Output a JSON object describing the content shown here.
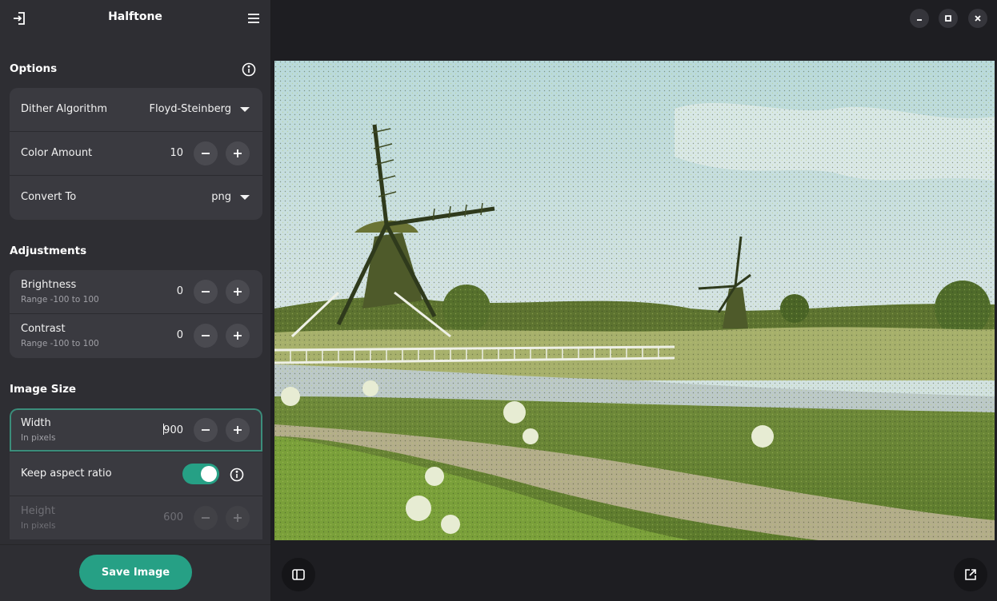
{
  "app": {
    "title": "Halftone"
  },
  "options": {
    "title": "Options",
    "dither_label": "Dither Algorithm",
    "dither_value": "Floyd-Steinberg",
    "color_label": "Color Amount",
    "color_value": "10",
    "convert_label": "Convert To",
    "convert_value": "png"
  },
  "adjustments": {
    "title": "Adjustments",
    "brightness_label": "Brightness",
    "brightness_sub": "Range -100 to 100",
    "brightness_value": "0",
    "contrast_label": "Contrast",
    "contrast_sub": "Range -100 to 100",
    "contrast_value": "0"
  },
  "image_size": {
    "title": "Image Size",
    "width_label": "Width",
    "width_sub": "In pixels",
    "width_value": "900",
    "keep_aspect_label": "Keep aspect ratio",
    "keep_aspect_on": true,
    "height_label": "Height",
    "height_sub": "In pixels",
    "height_value": "600"
  },
  "footer": {
    "save_label": "Save Image"
  },
  "colors": {
    "accent": "#26a085",
    "sidebar_bg": "#2e2e33",
    "main_bg": "#1e1e22",
    "group_bg": "#3a3a40"
  },
  "icons": {
    "open": "open-file-icon",
    "menu": "hamburger-menu-icon",
    "info": "info-icon",
    "minus": "minus-icon",
    "plus": "plus-icon",
    "dropdown": "dropdown-caret-icon",
    "minimize": "minimize-icon",
    "maximize": "maximize-icon",
    "close": "close-icon",
    "sidebar_toggle": "sidebar-toggle-icon",
    "external": "open-external-icon"
  }
}
